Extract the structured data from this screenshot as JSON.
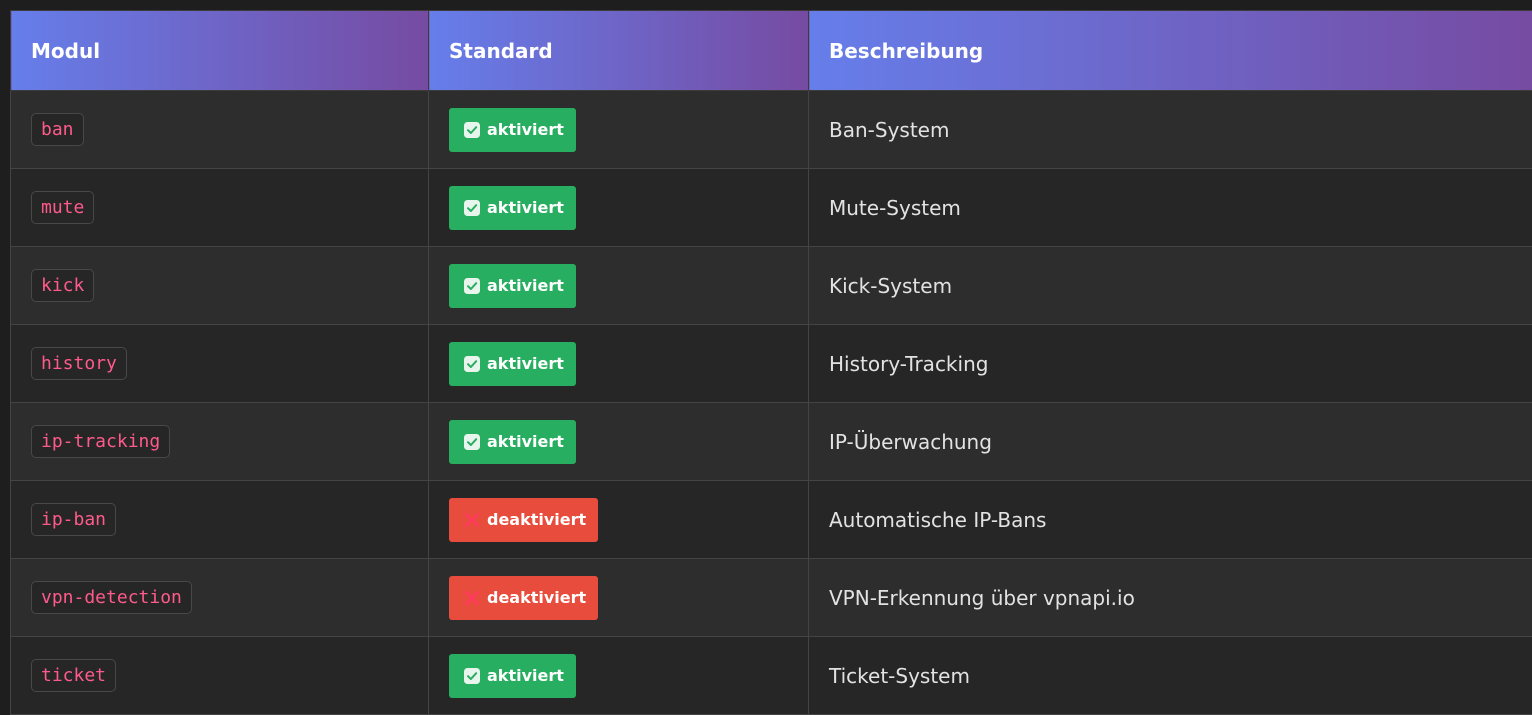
{
  "table": {
    "headers": [
      "Modul",
      "Standard",
      "Beschreibung"
    ],
    "rows": [
      {
        "module": "ban",
        "state": "on",
        "status": "aktiviert",
        "description": "Ban-System"
      },
      {
        "module": "mute",
        "state": "on",
        "status": "aktiviert",
        "description": "Mute-System"
      },
      {
        "module": "kick",
        "state": "on",
        "status": "aktiviert",
        "description": "Kick-System"
      },
      {
        "module": "history",
        "state": "on",
        "status": "aktiviert",
        "description": "History-Tracking"
      },
      {
        "module": "ip-tracking",
        "state": "on",
        "status": "aktiviert",
        "description": "IP-Überwachung"
      },
      {
        "module": "ip-ban",
        "state": "off",
        "status": "deaktiviert",
        "description": "Automatische IP-Bans"
      },
      {
        "module": "vpn-detection",
        "state": "off",
        "status": "deaktiviert",
        "description": "VPN-Erkennung über vpnapi.io"
      },
      {
        "module": "ticket",
        "state": "on",
        "status": "aktiviert",
        "description": "Ticket-System"
      }
    ]
  },
  "icons": {
    "on": "check-box-icon",
    "off": "cross-mark-icon"
  },
  "colors": {
    "header_gradient_start": "#667eea",
    "header_gradient_end": "#764ba2",
    "enabled": "#27ae60",
    "disabled": "#e74c3c",
    "module_code_text": "#ff5a8c"
  }
}
